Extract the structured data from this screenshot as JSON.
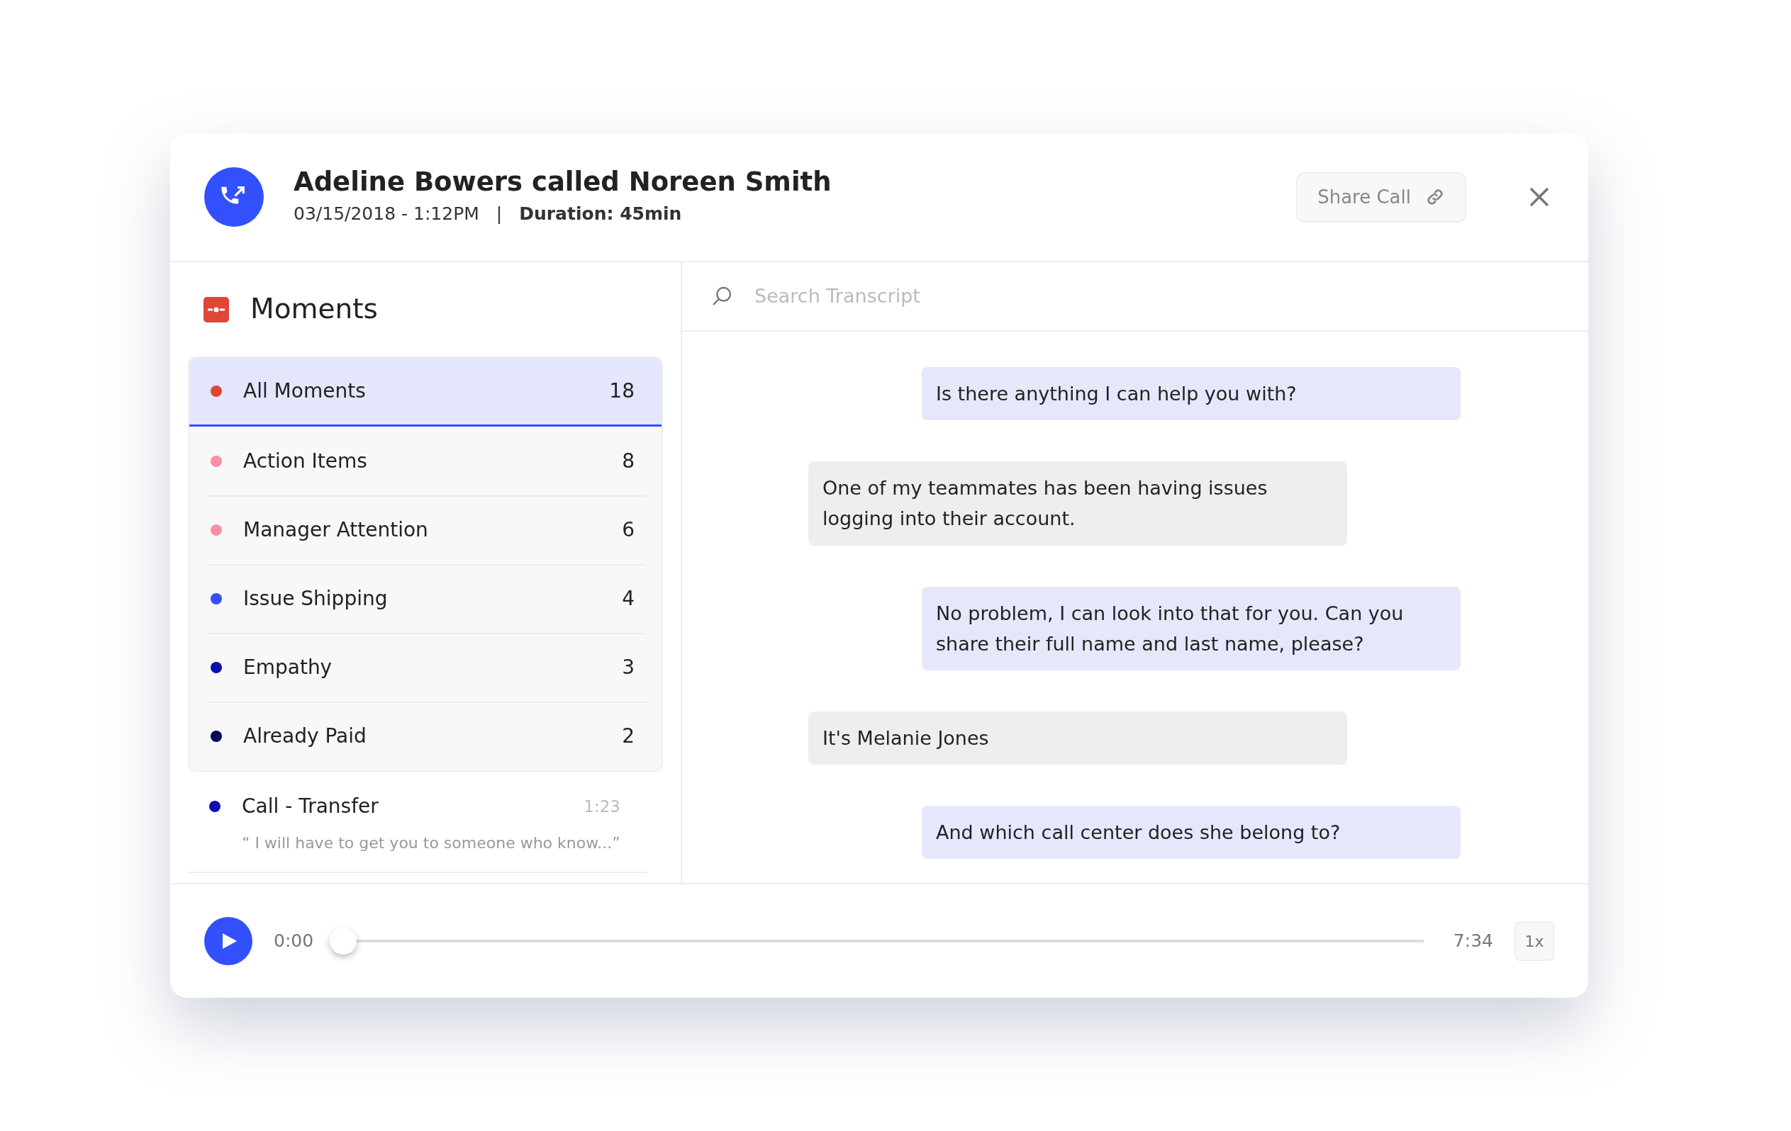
{
  "call": {
    "title": "Adeline Bowers called Noreen Smith",
    "datetime": "03/15/2018 - 1:12PM",
    "separator": "|",
    "duration": "Duration: 45min",
    "share_button": "Share Call"
  },
  "moments": {
    "title": "Moments",
    "items": [
      {
        "label": "All Moments",
        "count": "18",
        "color": "#e04535",
        "selected": true
      },
      {
        "label": "Action Items",
        "count": "8",
        "color": "#f98fa3",
        "selected": false
      },
      {
        "label": "Manager Attention",
        "count": "6",
        "color": "#f98fa3",
        "selected": false
      },
      {
        "label": "Issue Shipping",
        "count": "4",
        "color": "#3350ff",
        "selected": false
      },
      {
        "label": "Empathy",
        "count": "3",
        "color": "#0a0fb0",
        "selected": false
      },
      {
        "label": "Already Paid",
        "count": "2",
        "color": "#05065a",
        "selected": false
      }
    ],
    "clips": [
      {
        "label": "Call - Transfer",
        "time": "1:23",
        "quote": "“ I will have to get you to someone who know...”",
        "color": "#0a0fb0"
      }
    ]
  },
  "search": {
    "placeholder": "Search Transcript"
  },
  "messages": [
    {
      "kind": "agent",
      "text": "Is there anything I can help you with?"
    },
    {
      "kind": "customer",
      "text": "One of my teammates has been having issues logging into their account."
    },
    {
      "kind": "agent",
      "text": "No problem, I can look into that for you. Can you share their full name and last name, please?"
    },
    {
      "kind": "customer",
      "text": "It's Melanie Jones"
    },
    {
      "kind": "agent",
      "text": "And which call center does she belong to?"
    }
  ],
  "player": {
    "current": "0:00",
    "level": 0,
    "total": "7:34",
    "speed": "1x"
  }
}
